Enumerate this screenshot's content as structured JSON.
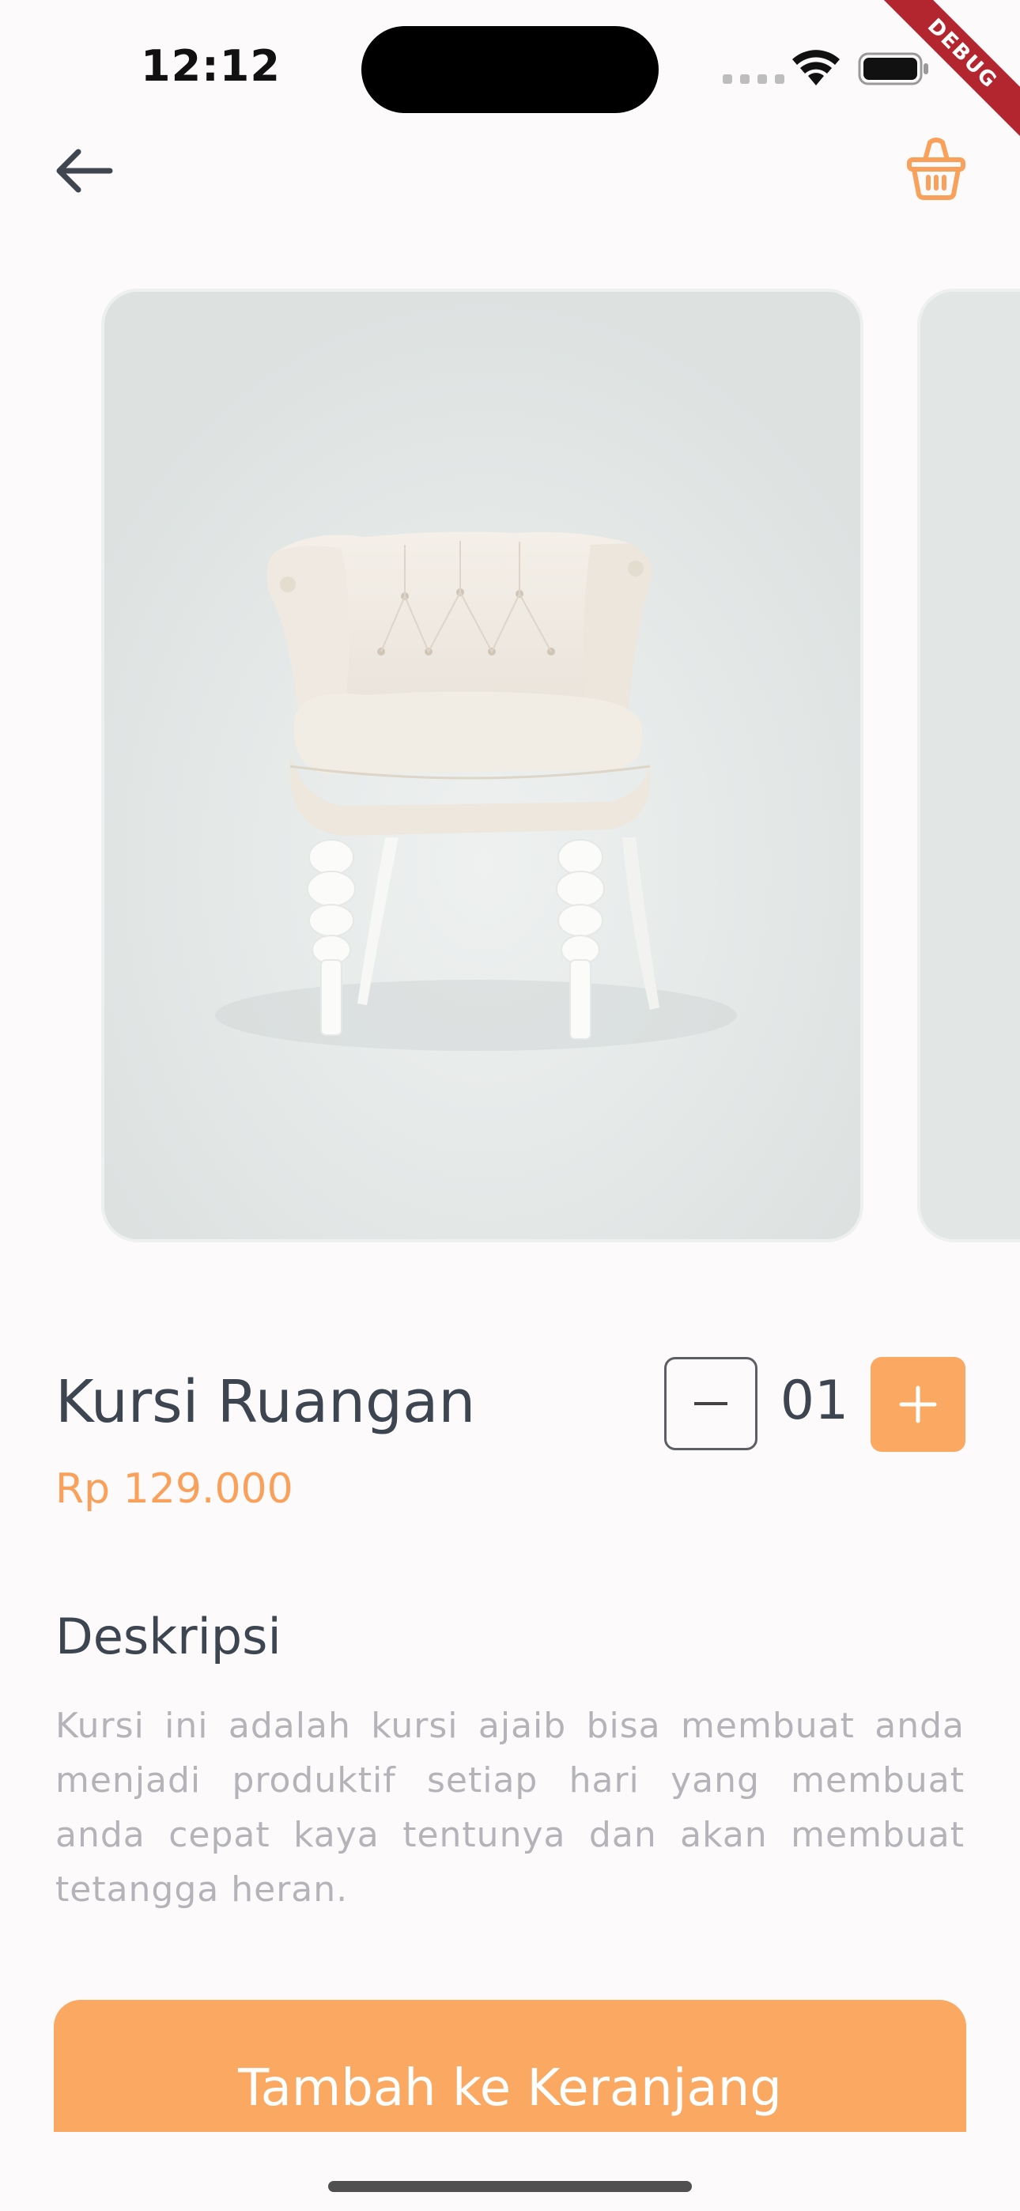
{
  "status_bar": {
    "time": "12:12",
    "debug_label": "DEBUG"
  },
  "header": {
    "back_icon": "arrow-left-icon",
    "cart_icon": "basket-icon"
  },
  "product": {
    "name": "Kursi Ruangan",
    "price": "Rp 129.000",
    "quantity": "01",
    "image_label": "white tufted armchair"
  },
  "description": {
    "title": "Deskripsi",
    "text": "Kursi ini adalah kursi ajaib bisa membuat anda menjadi produktif setiap hari yang membuat anda cepat kaya tentunya dan akan membuat tetangga heran."
  },
  "actions": {
    "add_to_cart": "Tambah ke Keranjang"
  },
  "colors": {
    "accent": "#faa862",
    "price": "#f9a15a",
    "text_dark": "#3d4550",
    "text_muted": "#b3b3b8",
    "background": "#fdfafc"
  }
}
